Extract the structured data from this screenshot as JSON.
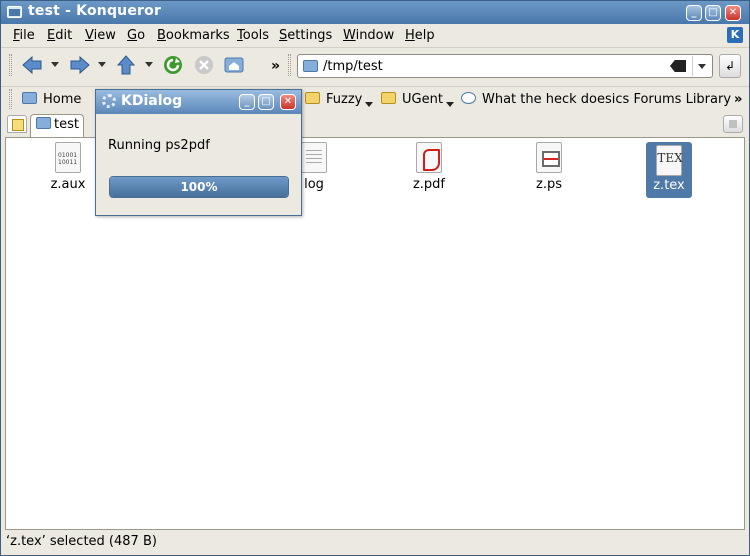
{
  "window": {
    "title": "test - Konqueror"
  },
  "menubar": {
    "items": [
      {
        "label": "File",
        "u": "F",
        "rest": "ile"
      },
      {
        "label": "Edit",
        "u": "E",
        "rest": "dit"
      },
      {
        "label": "View",
        "u": "V",
        "rest": "iew"
      },
      {
        "label": "Go",
        "u": "G",
        "rest": "o"
      },
      {
        "label": "Bookmarks",
        "u": "B",
        "rest": "ookmarks"
      },
      {
        "label": "Tools",
        "u": "T",
        "rest": "ools"
      },
      {
        "label": "Settings",
        "u": "S",
        "rest": "ettings"
      },
      {
        "label": "Window",
        "u": "W",
        "rest": "indow"
      },
      {
        "label": "Help",
        "u": "H",
        "rest": "elp"
      }
    ]
  },
  "toolbar": {
    "more": "»",
    "location_value": "/tmp/test",
    "go_symbol": "↲",
    "icons": {
      "back": "back-arrow-icon",
      "forward": "forward-arrow-icon",
      "up": "up-arrow-icon",
      "reload": "reload-icon",
      "stop": "stop-icon",
      "home": "home-icon"
    }
  },
  "bookmarks": {
    "items": [
      {
        "label": "Home"
      },
      {
        "label": "Fuzzy"
      },
      {
        "label": "UGent"
      },
      {
        "label": "What the heck does"
      },
      {
        "label": "ics Forums"
      },
      {
        "label": "Library"
      }
    ],
    "more": "»"
  },
  "tabs": [
    {
      "label": "test"
    }
  ],
  "files": [
    {
      "name": "z.aux"
    },
    {
      "name": "log"
    },
    {
      "name": "z.pdf"
    },
    {
      "name": "z.ps"
    },
    {
      "name": "z.tex",
      "selected": true
    }
  ],
  "status": {
    "text": "‘z.tex’ selected (487 B)"
  },
  "dialog": {
    "title": "KDialog",
    "message": "Running ps2pdf",
    "progress": 100,
    "progress_label": "100%"
  },
  "colors": {
    "title_blue": "#4a78aa",
    "selection": "#4f7aa8",
    "progress": "#466f9b"
  }
}
